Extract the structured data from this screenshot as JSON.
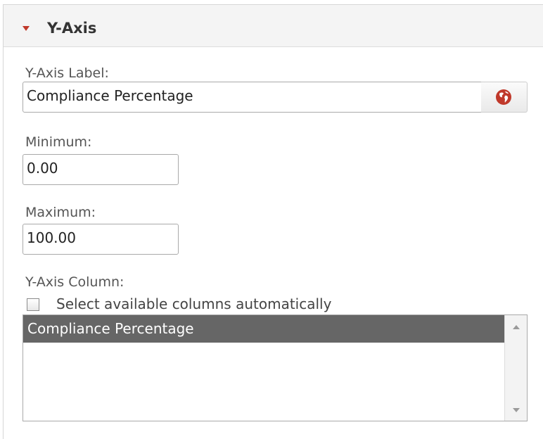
{
  "section": {
    "title": "Y-Axis",
    "caret_icon": "caret-down-icon",
    "accent_color": "#c0392b"
  },
  "y_axis_label": {
    "label": "Y-Axis Label:",
    "value": "Compliance Percentage",
    "button_icon": "globe-icon"
  },
  "minimum": {
    "label": "Minimum:",
    "value": "0.00"
  },
  "maximum": {
    "label": "Maximum:",
    "value": "100.00"
  },
  "y_axis_column": {
    "label": "Y-Axis Column:",
    "auto_select_label": "Select available columns automatically",
    "auto_select_checked": false,
    "items": [
      "Compliance Percentage"
    ],
    "selected_item": "Compliance Percentage"
  }
}
